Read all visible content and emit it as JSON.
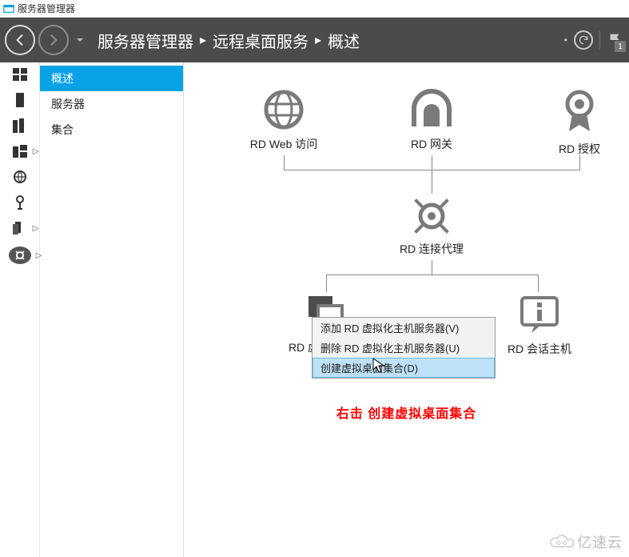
{
  "title": "服务器管理器",
  "breadcrumbs": {
    "a": "服务器管理器",
    "b": "远程桌面服务",
    "c": "概述"
  },
  "header": {
    "refresh_dropdown": "•",
    "flag_count": "1"
  },
  "iconstrip": {
    "dashboard": "dashboard-icon",
    "local": "local-server-icon",
    "all": "all-servers-icon",
    "files": "file-services-icon",
    "iis": "iis-icon",
    "security": "security-icon",
    "rds": "rds-icon",
    "rds_selected": "rds-selected-icon"
  },
  "sidebar": {
    "items": [
      "概述",
      "服务器",
      "集合"
    ]
  },
  "diagram": {
    "web": "RD Web 访问",
    "gateway": "RD 网关",
    "licensing": "RD 授权",
    "broker": "RD 连接代理",
    "vhost": "RD 虚拟化主机",
    "session": "RD 会话主机"
  },
  "context_menu": {
    "add": "添加 RD 虚拟化主机服务器(V)",
    "remove": "删除 RD 虚拟化主机服务器(U)",
    "create": "创建虚拟桌面集合(D)"
  },
  "hint": "右击  创建虚拟桌面集合",
  "watermark": "亿速云"
}
